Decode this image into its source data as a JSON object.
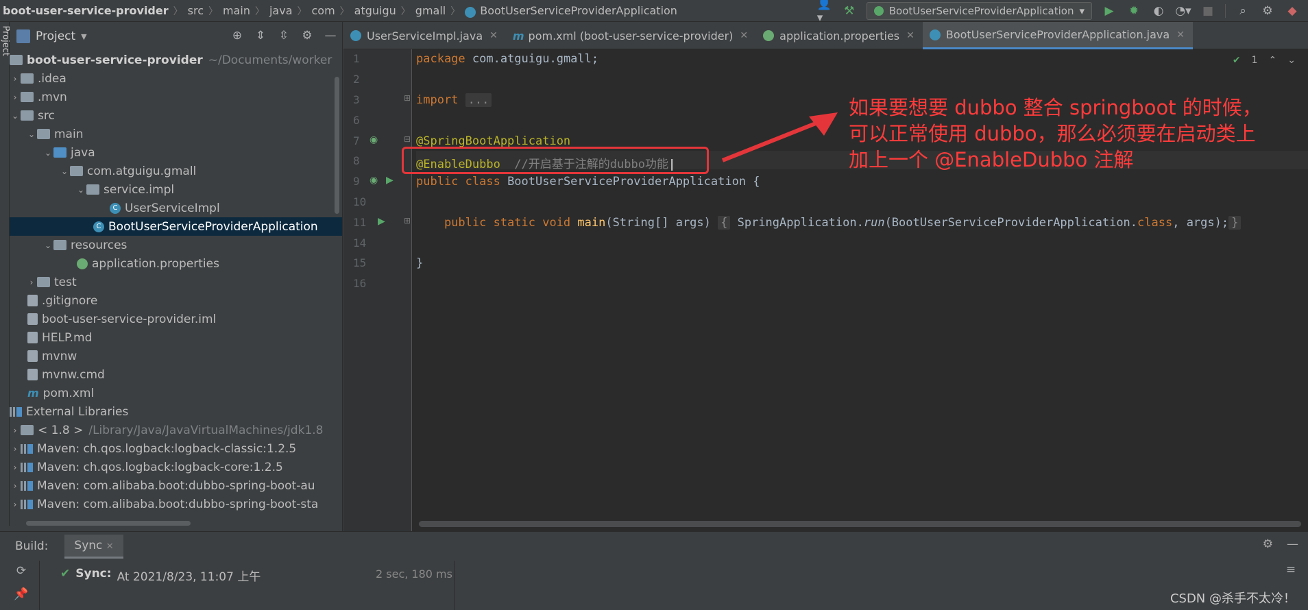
{
  "breadcrumbs": [
    "boot-user-service-provider",
    "src",
    "main",
    "java",
    "com",
    "atguigu",
    "gmall",
    "BootUserServiceProviderApplication"
  ],
  "run_config": "BootUserServiceProviderApplication",
  "left_stripe_label": "Project",
  "project": {
    "title": "Project",
    "root_name": "boot-user-service-provider",
    "root_path": "~/Documents/worker",
    "items": [
      {
        "label": "idea",
        "prefix": "."
      },
      {
        "label": ".mvn"
      },
      {
        "label": "src"
      },
      {
        "label": "main"
      },
      {
        "label": "java"
      },
      {
        "label": "com.atguigu.gmall"
      },
      {
        "label": "service.impl"
      },
      {
        "label": "UserServiceImpl"
      },
      {
        "label": "BootUserServiceProviderApplication"
      },
      {
        "label": "resources"
      },
      {
        "label": "application.properties"
      },
      {
        "label": "test"
      },
      {
        "label": ".gitignore"
      },
      {
        "label": "boot-user-service-provider.iml"
      },
      {
        "label": "HELP.md"
      },
      {
        "label": "mvnw"
      },
      {
        "label": "mvnw.cmd"
      },
      {
        "label": "pom.xml"
      },
      {
        "label": "External Libraries"
      },
      {
        "label": "< 1.8 >",
        "detail": "/Library/Java/JavaVirtualMachines/jdk1.8"
      },
      {
        "label": "Maven: ch.qos.logback:logback-classic:1.2.5"
      },
      {
        "label": "Maven: ch.qos.logback:logback-core:1.2.5"
      },
      {
        "label": "Maven: com.alibaba.boot:dubbo-spring-boot-au"
      },
      {
        "label": "Maven: com.alibaba.boot:dubbo-spring-boot-sta"
      }
    ]
  },
  "tabs": [
    {
      "label": "UserServiceImpl.java"
    },
    {
      "label": "pom.xml (boot-user-service-provider)"
    },
    {
      "label": "application.properties"
    },
    {
      "label": "BootUserServiceProviderApplication.java"
    }
  ],
  "editor": {
    "line_numbers": [
      "1",
      "2",
      "3",
      "6",
      "7",
      "8",
      "9",
      "10",
      "11",
      "14",
      "15",
      "16"
    ],
    "inspection_count": "1",
    "code": {
      "l1_kw": "package",
      "l1_rest": " com.atguigu.gmall;",
      "l3_kw": "import",
      "l3_fold": "...",
      "l7": "@SpringBootApplication",
      "l8_ann": "@EnableDubbo",
      "l8_cmt": "  //开启基于注解的dubbo功能",
      "l9_kw": "public class",
      "l9_rest": " BootUserServiceProviderApplication {",
      "l11_kw": "    public static void",
      "l11_name": " main",
      "l11_args": "(String[] args) ",
      "l11_fold_open": "{",
      "l11_body1": " SpringApplication.",
      "l11_run": "run",
      "l11_body2": "(BootUserServiceProviderApplication.",
      "l11_class": "class",
      "l11_body3": ", args);",
      "l11_fold_close": "}",
      "l15": "}"
    }
  },
  "annotation_note": "如果要想要 dubbo 整合 springboot 的时候，可以正常使用 dubbo，那么必须要在启动类上加上一个 @EnableDubbo 注解",
  "build": {
    "label": "Build:",
    "tab": "Sync",
    "sync_label": "Sync:",
    "sync_text": "At 2021/8/23, 11:07 上午",
    "duration": "2 sec, 180 ms"
  },
  "watermark": "CSDN @杀手不太冷！"
}
